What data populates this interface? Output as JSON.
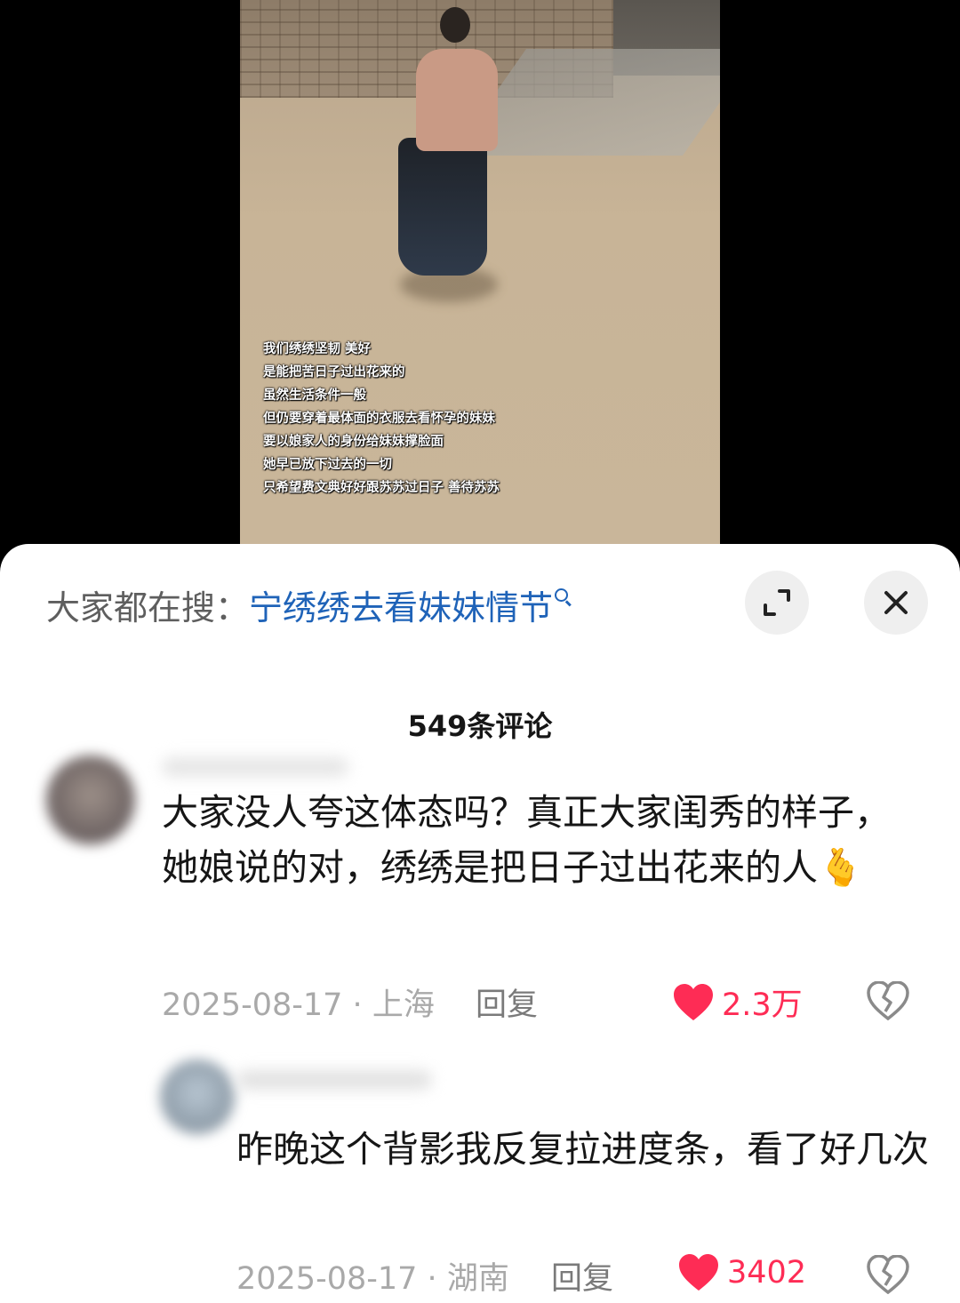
{
  "video": {
    "subtitles": [
      "我们绣绣坚韧 美好",
      "是能把苦日子过出花来的",
      "虽然生活条件一般",
      "但仍要穿着最体面的衣服去看怀孕的妹妹",
      "要以娘家人的身份给妹妹撑脸面",
      "她早已放下过去的一切",
      "只希望费文典好好跟苏苏过日子 善待苏苏"
    ]
  },
  "search_bar": {
    "prefix": "大家都在搜：",
    "term": "宁绣绣去看妹妹情节",
    "search_icon": "search-icon",
    "expand_icon": "expand-icon",
    "close_icon": "close-icon"
  },
  "comments_header": {
    "count_label": "549条评论"
  },
  "comments": [
    {
      "text": "大家没人夸这体态吗？真正大家闺秀的样子，她娘说的对，绣绣是把日子过出花来的人🫰",
      "date": "2025-08-17",
      "location": "上海",
      "reply_label": "回复",
      "likes": "2.3万"
    },
    {
      "text": "昨晚这个背影我反复拉进度条，看了好几次",
      "date": "2025-08-17",
      "location": "湖南",
      "reply_label": "回复",
      "likes": "3402"
    }
  ],
  "colors": {
    "like_red": "#fe2c55",
    "link_blue": "#1f63b8",
    "meta_gray": "#a9a9a9"
  }
}
